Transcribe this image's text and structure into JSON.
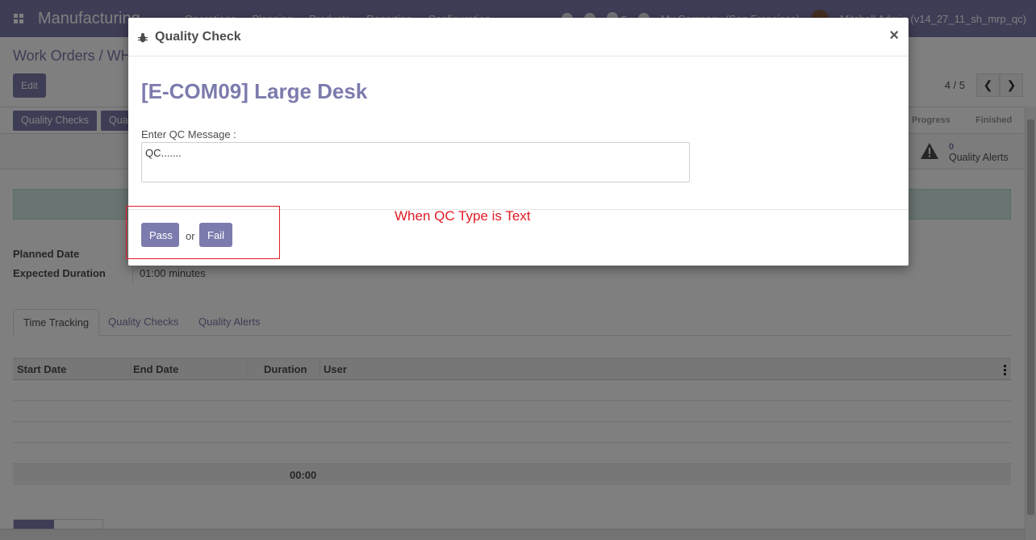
{
  "navbar": {
    "app_name": "Manufacturing",
    "menu": [
      "Operations",
      "Planning",
      "Products",
      "Reporting",
      "Configuration"
    ],
    "chat_count": "5",
    "company": "My Company (San Francisco)",
    "user": "Mitchell Admin (v14_27_11_sh_mrp_qc)"
  },
  "control_panel": {
    "breadcrumb": "Work Orders / WH",
    "edit_label": "Edit",
    "pager_value": "4 / 5"
  },
  "statusbar": {
    "quality_checks_label": "Quality Checks",
    "second_button_label": "Qua",
    "stages": [
      "Progress",
      "Finished"
    ]
  },
  "alerts": {
    "count": "0",
    "label": "Quality Alerts"
  },
  "fields": {
    "planned_date_label": "Planned Date",
    "expected_duration_label": "Expected Duration",
    "expected_duration_value": "01:00 minutes"
  },
  "notebook": {
    "tabs": [
      "Time Tracking",
      "Quality Checks",
      "Quality Alerts"
    ]
  },
  "time_table": {
    "columns": [
      "Start Date",
      "End Date",
      "Duration",
      "User"
    ],
    "total_duration": "00:00"
  },
  "modal": {
    "title": "Quality Check",
    "product": "[E-COM09] Large Desk",
    "message_label": "Enter QC Message :",
    "message_value": "QC.......",
    "pass_label": "Pass",
    "or_text": "or",
    "fail_label": "Fail"
  },
  "annotation": {
    "text": "When QC Type is Text",
    "color": "#e01b24"
  },
  "colors": {
    "primary": "#7c7bad",
    "alert_banner": "#d4e9e4"
  }
}
